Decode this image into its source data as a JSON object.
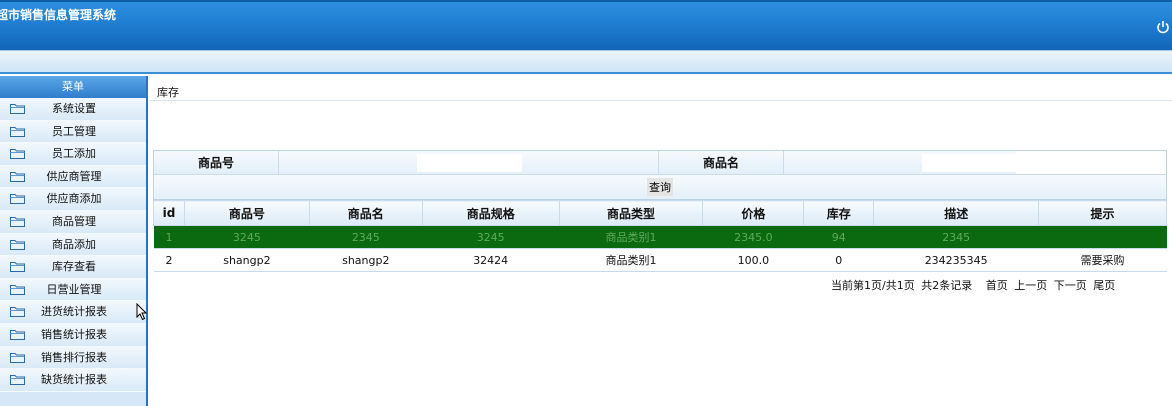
{
  "header": {
    "title": "超市销售信息管理系统",
    "power_icon": "power-icon"
  },
  "sidebar": {
    "title": "菜单",
    "items": [
      {
        "label": "系统设置"
      },
      {
        "label": "员工管理"
      },
      {
        "label": "员工添加"
      },
      {
        "label": "供应商管理"
      },
      {
        "label": "供应商添加"
      },
      {
        "label": "商品管理"
      },
      {
        "label": "商品添加"
      },
      {
        "label": "库存查看"
      },
      {
        "label": "日营业管理"
      },
      {
        "label": "进货统计报表"
      },
      {
        "label": "销售统计报表"
      },
      {
        "label": "销售排行报表"
      },
      {
        "label": "缺货统计报表"
      }
    ]
  },
  "content": {
    "breadcrumb": "库存",
    "search": {
      "product_id_label": "商品号",
      "product_id_value": "",
      "product_name_label": "商品名",
      "product_name_value": "",
      "query_label": "查询"
    },
    "table": {
      "headers": [
        "id",
        "商品号",
        "商品名",
        "商品规格",
        "商品类型",
        "价格",
        "库存",
        "描述",
        "提示"
      ],
      "rows": [
        [
          "1",
          "3245",
          "2345",
          "3245",
          "商品类别1",
          "2345.0",
          "94",
          "2345",
          ""
        ],
        [
          "2",
          "shangp2",
          "shangp2",
          "32424",
          "商品类别1",
          "100.0",
          "0",
          "234235345",
          "需要采购"
        ]
      ]
    },
    "pager": {
      "page_info": "当前第1页/共1页",
      "total": "共2条记录",
      "first": "首页",
      "prev": "上一页",
      "next": "下一页",
      "last": "尾页"
    }
  },
  "colors": {
    "header_blue": "#1f7ed1",
    "selected_row": "#0b6a0f",
    "sidebar_bg": "#d6e8f7"
  }
}
